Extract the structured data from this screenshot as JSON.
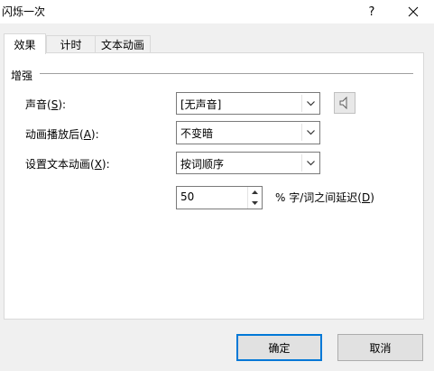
{
  "window": {
    "title": "闪烁一次",
    "help_label": "?"
  },
  "tabs": [
    {
      "label": "效果",
      "active": true
    },
    {
      "label": "计时",
      "active": false
    },
    {
      "label": "文本动画",
      "active": false
    }
  ],
  "group": {
    "label": "增强"
  },
  "fields": {
    "sound": {
      "label_prefix": "声音(",
      "accel": "S",
      "label_suffix": "):",
      "value": "[无声音]"
    },
    "after_animation": {
      "label_prefix": "动画播放后(",
      "accel": "A",
      "label_suffix": "):",
      "value": "不变暗"
    },
    "animate_text": {
      "label_prefix": "设置文本动画(",
      "accel": "X",
      "label_suffix": "):",
      "value": "按词顺序"
    },
    "delay": {
      "value": "50",
      "suffix_prefix": "% 字/词之间延迟(",
      "accel": "D",
      "suffix_suffix": ")"
    }
  },
  "buttons": {
    "ok_label": "确定",
    "cancel_label": "取消"
  },
  "colors": {
    "accent": "#0078d7",
    "panel_bg": "#ffffff",
    "dialog_bg": "#f0f0f0"
  },
  "icons": {
    "sound": "speaker-icon",
    "combo_arrow": "chevron-down-icon",
    "close": "close-icon"
  }
}
